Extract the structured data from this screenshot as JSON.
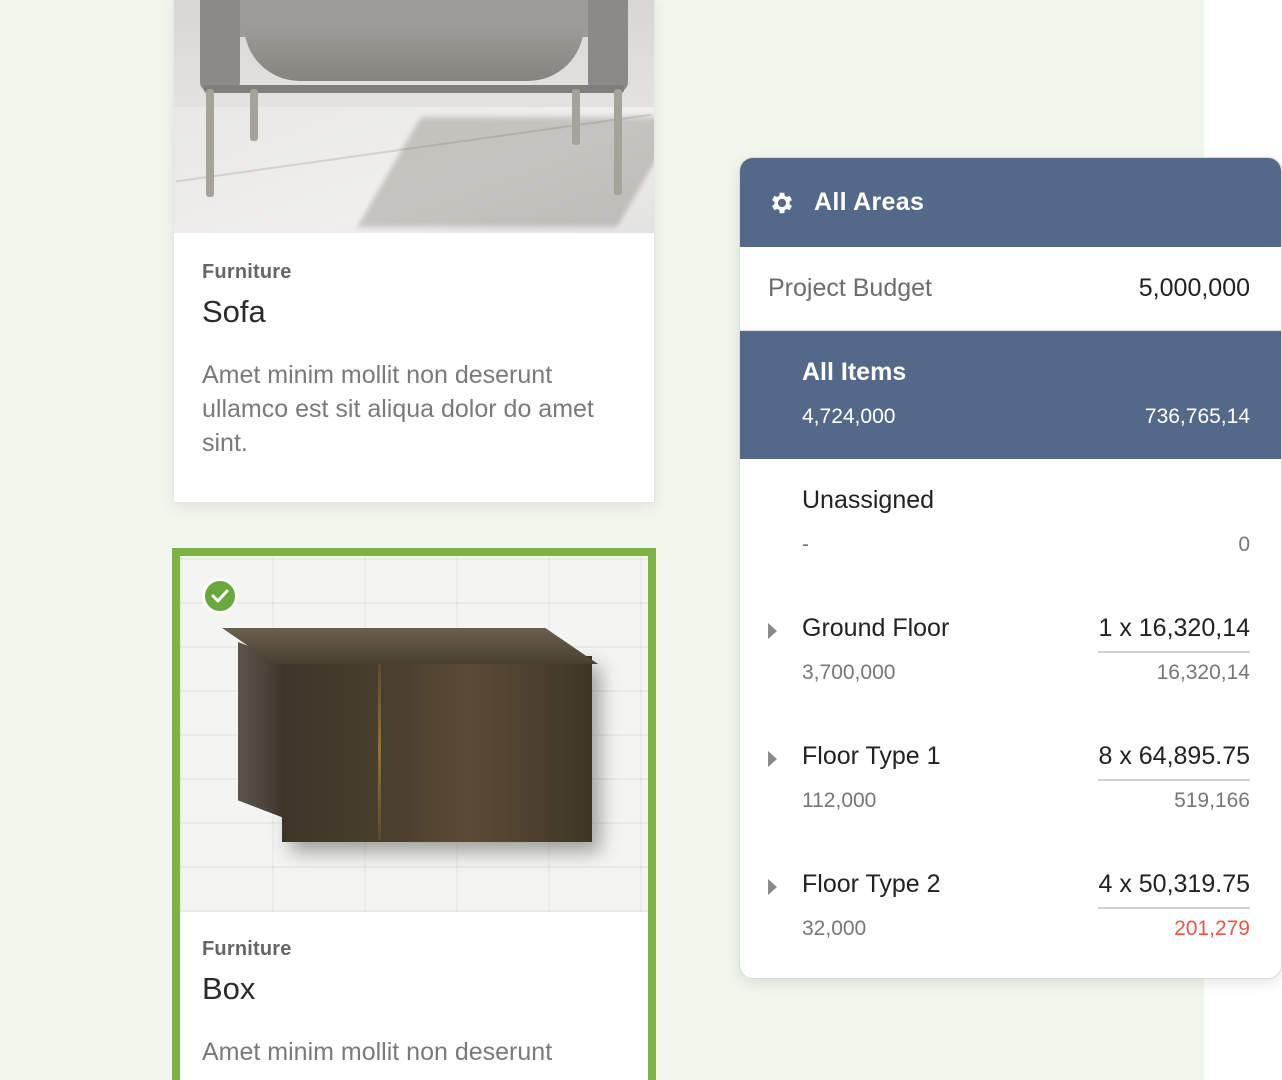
{
  "cards": [
    {
      "category": "Furniture",
      "title": "Sofa",
      "description": "Amet minim mollit non deserunt ullamco est sit aliqua dolor do amet sint.",
      "selected": false
    },
    {
      "category": "Furniture",
      "title": "Box",
      "description": "Amet minim mollit non deserunt",
      "selected": true
    }
  ],
  "panel": {
    "header": {
      "icon": "gear-icon",
      "title": "All Areas"
    },
    "budget": {
      "label": "Project Budget",
      "value": "5,000,000"
    },
    "rows": [
      {
        "name": "All Items",
        "sub_left": "4,724,000",
        "main_right": "",
        "sub_right": "736,765,14",
        "selected": true,
        "expandable": false
      },
      {
        "name": "Unassigned",
        "sub_left": "-",
        "main_right": "",
        "sub_right": "0",
        "selected": false,
        "expandable": false
      },
      {
        "name": "Ground Floor",
        "sub_left": "3,700,000",
        "main_right": "1 x 16,320,14",
        "sub_right": "16,320,14",
        "selected": false,
        "expandable": true
      },
      {
        "name": "Floor Type 1",
        "sub_left": "112,000",
        "main_right": "8 x 64,895.75",
        "sub_right": "519,166",
        "selected": false,
        "expandable": true
      },
      {
        "name": "Floor Type 2",
        "sub_left": "32,000",
        "main_right": "4 x 50,319.75",
        "sub_right": "201,279",
        "selected": false,
        "expandable": true,
        "over_budget": true
      }
    ]
  },
  "colors": {
    "panel_header": "#54698a",
    "selected_border": "#7cb342",
    "over_budget": "#e8584a",
    "background": "#f1f7ec"
  }
}
